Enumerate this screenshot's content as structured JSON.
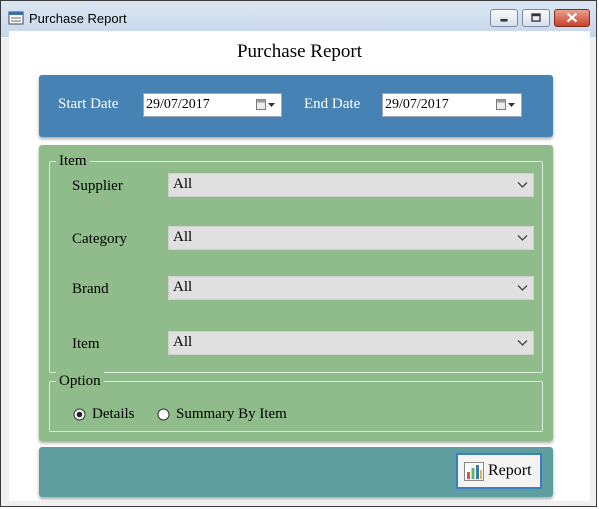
{
  "window": {
    "title": "Purchase Report",
    "icon": "report-app-icon",
    "controls": [
      "minimize-icon",
      "maximize-icon",
      "close-icon"
    ]
  },
  "page": {
    "title": "Purchase Report"
  },
  "dates": {
    "start_label": "Start Date",
    "start_value": "29/07/2017",
    "end_label": "End Date",
    "end_value": "29/07/2017",
    "picker_icon": "calendar-dropdown-icon"
  },
  "item_group": {
    "legend": "Item",
    "fields": [
      {
        "label": "Supplier",
        "value": "All"
      },
      {
        "label": "Category",
        "value": "All"
      },
      {
        "label": "Brand",
        "value": "All"
      },
      {
        "label": "Item",
        "value": "All"
      }
    ]
  },
  "option_group": {
    "legend": "Option",
    "options": [
      {
        "label": "Details",
        "selected": true
      },
      {
        "label": "Summary By Item",
        "selected": false
      }
    ]
  },
  "actions": {
    "report_label": "Report",
    "report_icon": "chart-icon"
  },
  "colors": {
    "date_panel": "#4682b4",
    "filter_panel": "#8fbc8a",
    "action_panel": "#5f9ea0"
  }
}
